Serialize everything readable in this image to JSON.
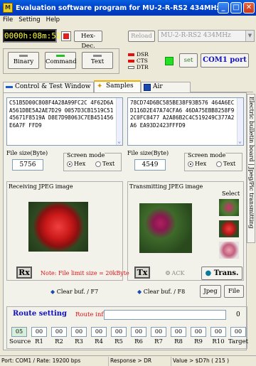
{
  "window": {
    "title": "Evaluation software program for MU-2-R-RS2 434MHz",
    "icon_letter": "M"
  },
  "menu": [
    "File",
    "Setting",
    "Help"
  ],
  "toolbar": {
    "timer": "0000h:08m:52s",
    "hex_dec_label": "Hex-Dec.",
    "reload_label": "Reload",
    "device_combo": "MU-2-R-RS2  434MHz"
  },
  "modes": {
    "binary": "Binary",
    "command": "Command",
    "text": "Text",
    "active": "Command"
  },
  "signals": {
    "dsr": "DSR",
    "cts": "CTS",
    "dtr": "DTR",
    "set_label": "set",
    "port_button": "COM1 port"
  },
  "tabs": [
    "Control & Test Window",
    "Samples",
    "Air Monitor"
  ],
  "side_tab": "Electric bulletin board | Jpeg/Pic transmitting",
  "receive": {
    "hex": "C51B5D00C808F4A28A99FC2C 4F62D6AA561DBE5A2AE7D29 0057D3CB1519C5145671F8519A D8E7D98063C7EB451456E6A7F FFD9",
    "file_size_label": "File size(Byte)",
    "file_size": "5756",
    "screen_mode_label": "Screen mode",
    "hex_option": "Hex",
    "text_option": "Text",
    "image_label": "Receiving JPEG image",
    "rx_label": "Rx",
    "note": "Note: File limit size = 20kByte",
    "clear_label": "Clear buf. / F7"
  },
  "transmit": {
    "hex": "78CD74D6BC585BE38F93B576 464A6ECD116D2E47A74CFA6 46DA75EBB8258F92C0FC8477 A2A86B2C4C519249C377A2A6 EA93D2423FFFD9",
    "file_size_label": "File size(Byte)",
    "file_size": "4549",
    "screen_mode_label": "Screen mode",
    "hex_option": "Hex",
    "text_option": "Text",
    "image_label": "Transmitting JPEG image",
    "select_label": "Select",
    "tx_label": "Tx",
    "ack_label": "ACK",
    "trans_label": "Trans.",
    "clear_label": "Clear buf. / F8",
    "jpeg_label": "Jpeg",
    "file_label": "File"
  },
  "route": {
    "title": "Route setting",
    "info_label": "Route inf.",
    "count": "0",
    "values": [
      "05",
      "00",
      "00",
      "00",
      "00",
      "00",
      "00",
      "00",
      "00",
      "00",
      "00",
      "00"
    ],
    "labels": [
      "Source",
      "R1",
      "R2",
      "R3",
      "R4",
      "R5",
      "R6",
      "R7",
      "R8",
      "R9",
      "R10",
      "Target"
    ]
  },
  "status": {
    "port": "Port: COM1 / Rate: 19200 bps",
    "response": "Response > DR",
    "value": "Value > $D7h ( 215 )"
  },
  "colors": {
    "titlebar": "#0044cc",
    "accent_red": "#e01010",
    "route_blue": "#1010c0",
    "led_green": "#22c022"
  }
}
